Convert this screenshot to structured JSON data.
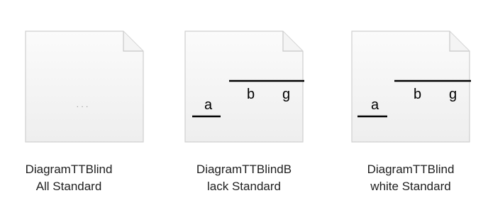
{
  "files": [
    {
      "name_line1": "DiagramTTBlind",
      "name_line2": "All Standard",
      "icon": "blank-document-icon",
      "thumbnail_text": ". . ."
    },
    {
      "name_line1": "DiagramTTBlindB",
      "name_line2": "lack Standard",
      "icon": "document-thumbnail-icon",
      "thumbnail_labels": [
        "a",
        "b",
        "g"
      ]
    },
    {
      "name_line1": "DiagramTTBlind",
      "name_line2": "white Standard",
      "icon": "document-thumbnail-icon",
      "thumbnail_labels": [
        "a",
        "b",
        "g"
      ]
    }
  ]
}
